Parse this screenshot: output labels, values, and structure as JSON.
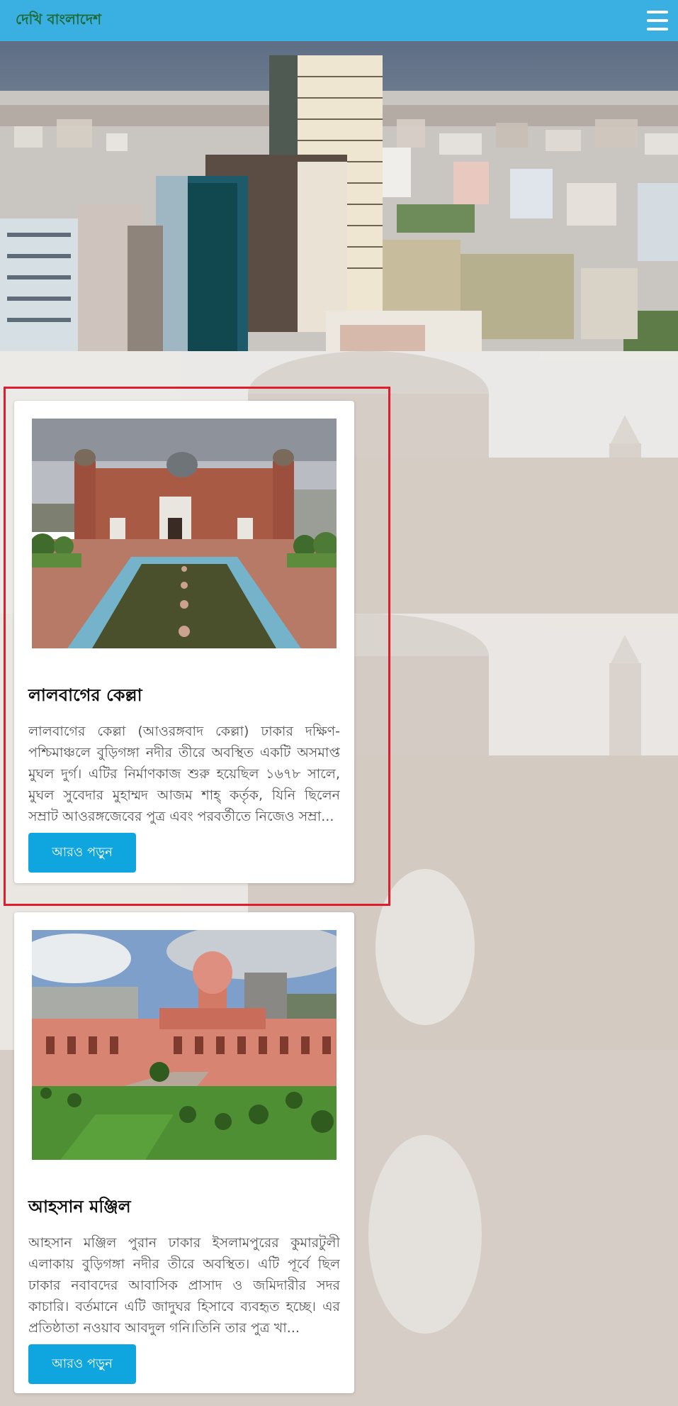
{
  "header": {
    "brand": "দেখি বাংলাদেশ",
    "menu_icon": "hamburger-menu-icon"
  },
  "colors": {
    "header_bg": "#3ab0e2",
    "button_bg": "#0fa5de",
    "highlight_border": "#e11d2b"
  },
  "cards": [
    {
      "title": "লালবাগের কেল্লা",
      "description": "লালবাগের কেল্লা (আওরঙ্গবাদ কেল্লা) ঢাকার দক্ষিণ-পশ্চিমাঞ্চলে বুড়িগঙ্গা নদীর তীরে অবস্থিত একটি অসমাপ্ত মুঘল দুর্গ। এটির নির্মাণকাজ শুরু হয়েছিল ১৬৭৮ সালে, মুঘল সুবেদার মুহাম্মদ আজম শাহ্‌ কর্তৃক, যিনি ছিলেন সম্রাট আওরঙ্গজেবের পুত্র এবং পরবর্তীতে নিজেও সম্রা...",
      "button": "আরও পড়ুন"
    },
    {
      "title": "আহসান মঞ্জিল",
      "description": "আহসান মঞ্জিল পুরান ঢাকার ইসলামপুরের কুমারটুলী এলাকায় বুড়িগঙ্গা নদীর তীরে অবস্থিত। এটি পূর্বে ছিল ঢাকার নবাবদের আবাসিক প্রাসাদ ও জমিদারীর সদর কাচারি। বর্তমানে এটি জাদুঘর হিসাবে ব্যবহৃত হচ্ছে। এর প্রতিষ্ঠাতা নওয়াব আবদুল গনি।তিনি তার পুত্র খা...",
      "button": "আরও পড়ুন"
    }
  ]
}
